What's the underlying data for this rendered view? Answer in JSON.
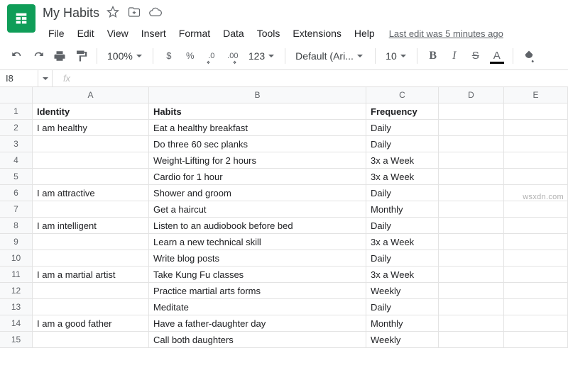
{
  "doc": {
    "title": "My Habits"
  },
  "menu": {
    "file": "File",
    "edit": "Edit",
    "view": "View",
    "insert": "Insert",
    "format": "Format",
    "data": "Data",
    "tools": "Tools",
    "extensions": "Extensions",
    "help": "Help",
    "last_edit": "Last edit was 5 minutes ago"
  },
  "toolbar": {
    "zoom": "100%",
    "currency": "$",
    "percent": "%",
    "dec_dec": ".0",
    "inc_dec": ".00",
    "more_formats": "123",
    "font": "Default (Ari...",
    "font_size": "10",
    "bold": "B",
    "italic": "I",
    "strike": "S",
    "text_color": "A"
  },
  "namebox": {
    "ref": "I8",
    "fx": "fx"
  },
  "columns": [
    "A",
    "B",
    "C",
    "D",
    "E"
  ],
  "rows": [
    {
      "n": "1",
      "a": "Identity",
      "b": "Habits",
      "c": "Frequency",
      "hdr": true
    },
    {
      "n": "2",
      "a": "I am healthy",
      "b": "Eat a healthy breakfast",
      "c": "Daily"
    },
    {
      "n": "3",
      "a": "",
      "b": "Do three 60 sec planks",
      "c": "Daily"
    },
    {
      "n": "4",
      "a": "",
      "b": "Weight-Lifting for 2 hours",
      "c": "3x a Week"
    },
    {
      "n": "5",
      "a": "",
      "b": "Cardio for 1 hour",
      "c": "3x a Week"
    },
    {
      "n": "6",
      "a": "I am attractive",
      "b": "Shower and groom",
      "c": "Daily"
    },
    {
      "n": "7",
      "a": "",
      "b": "Get a haircut",
      "c": "Monthly"
    },
    {
      "n": "8",
      "a": "I am intelligent",
      "b": "Listen to an audiobook before bed",
      "c": "Daily"
    },
    {
      "n": "9",
      "a": "",
      "b": "Learn a new technical skill",
      "c": "3x a Week"
    },
    {
      "n": "10",
      "a": "",
      "b": "Write blog posts",
      "c": "Daily"
    },
    {
      "n": "11",
      "a": "I am a martial artist",
      "b": "Take Kung Fu classes",
      "c": "3x a Week"
    },
    {
      "n": "12",
      "a": "",
      "b": "Practice martial arts forms",
      "c": "Weekly"
    },
    {
      "n": "13",
      "a": "",
      "b": "Meditate",
      "c": "Daily"
    },
    {
      "n": "14",
      "a": "I am a good father",
      "b": "Have a father-daughter day",
      "c": "Monthly"
    },
    {
      "n": "15",
      "a": "",
      "b": "Call both daughters",
      "c": "Weekly"
    }
  ],
  "watermark": "wsxdn.com"
}
